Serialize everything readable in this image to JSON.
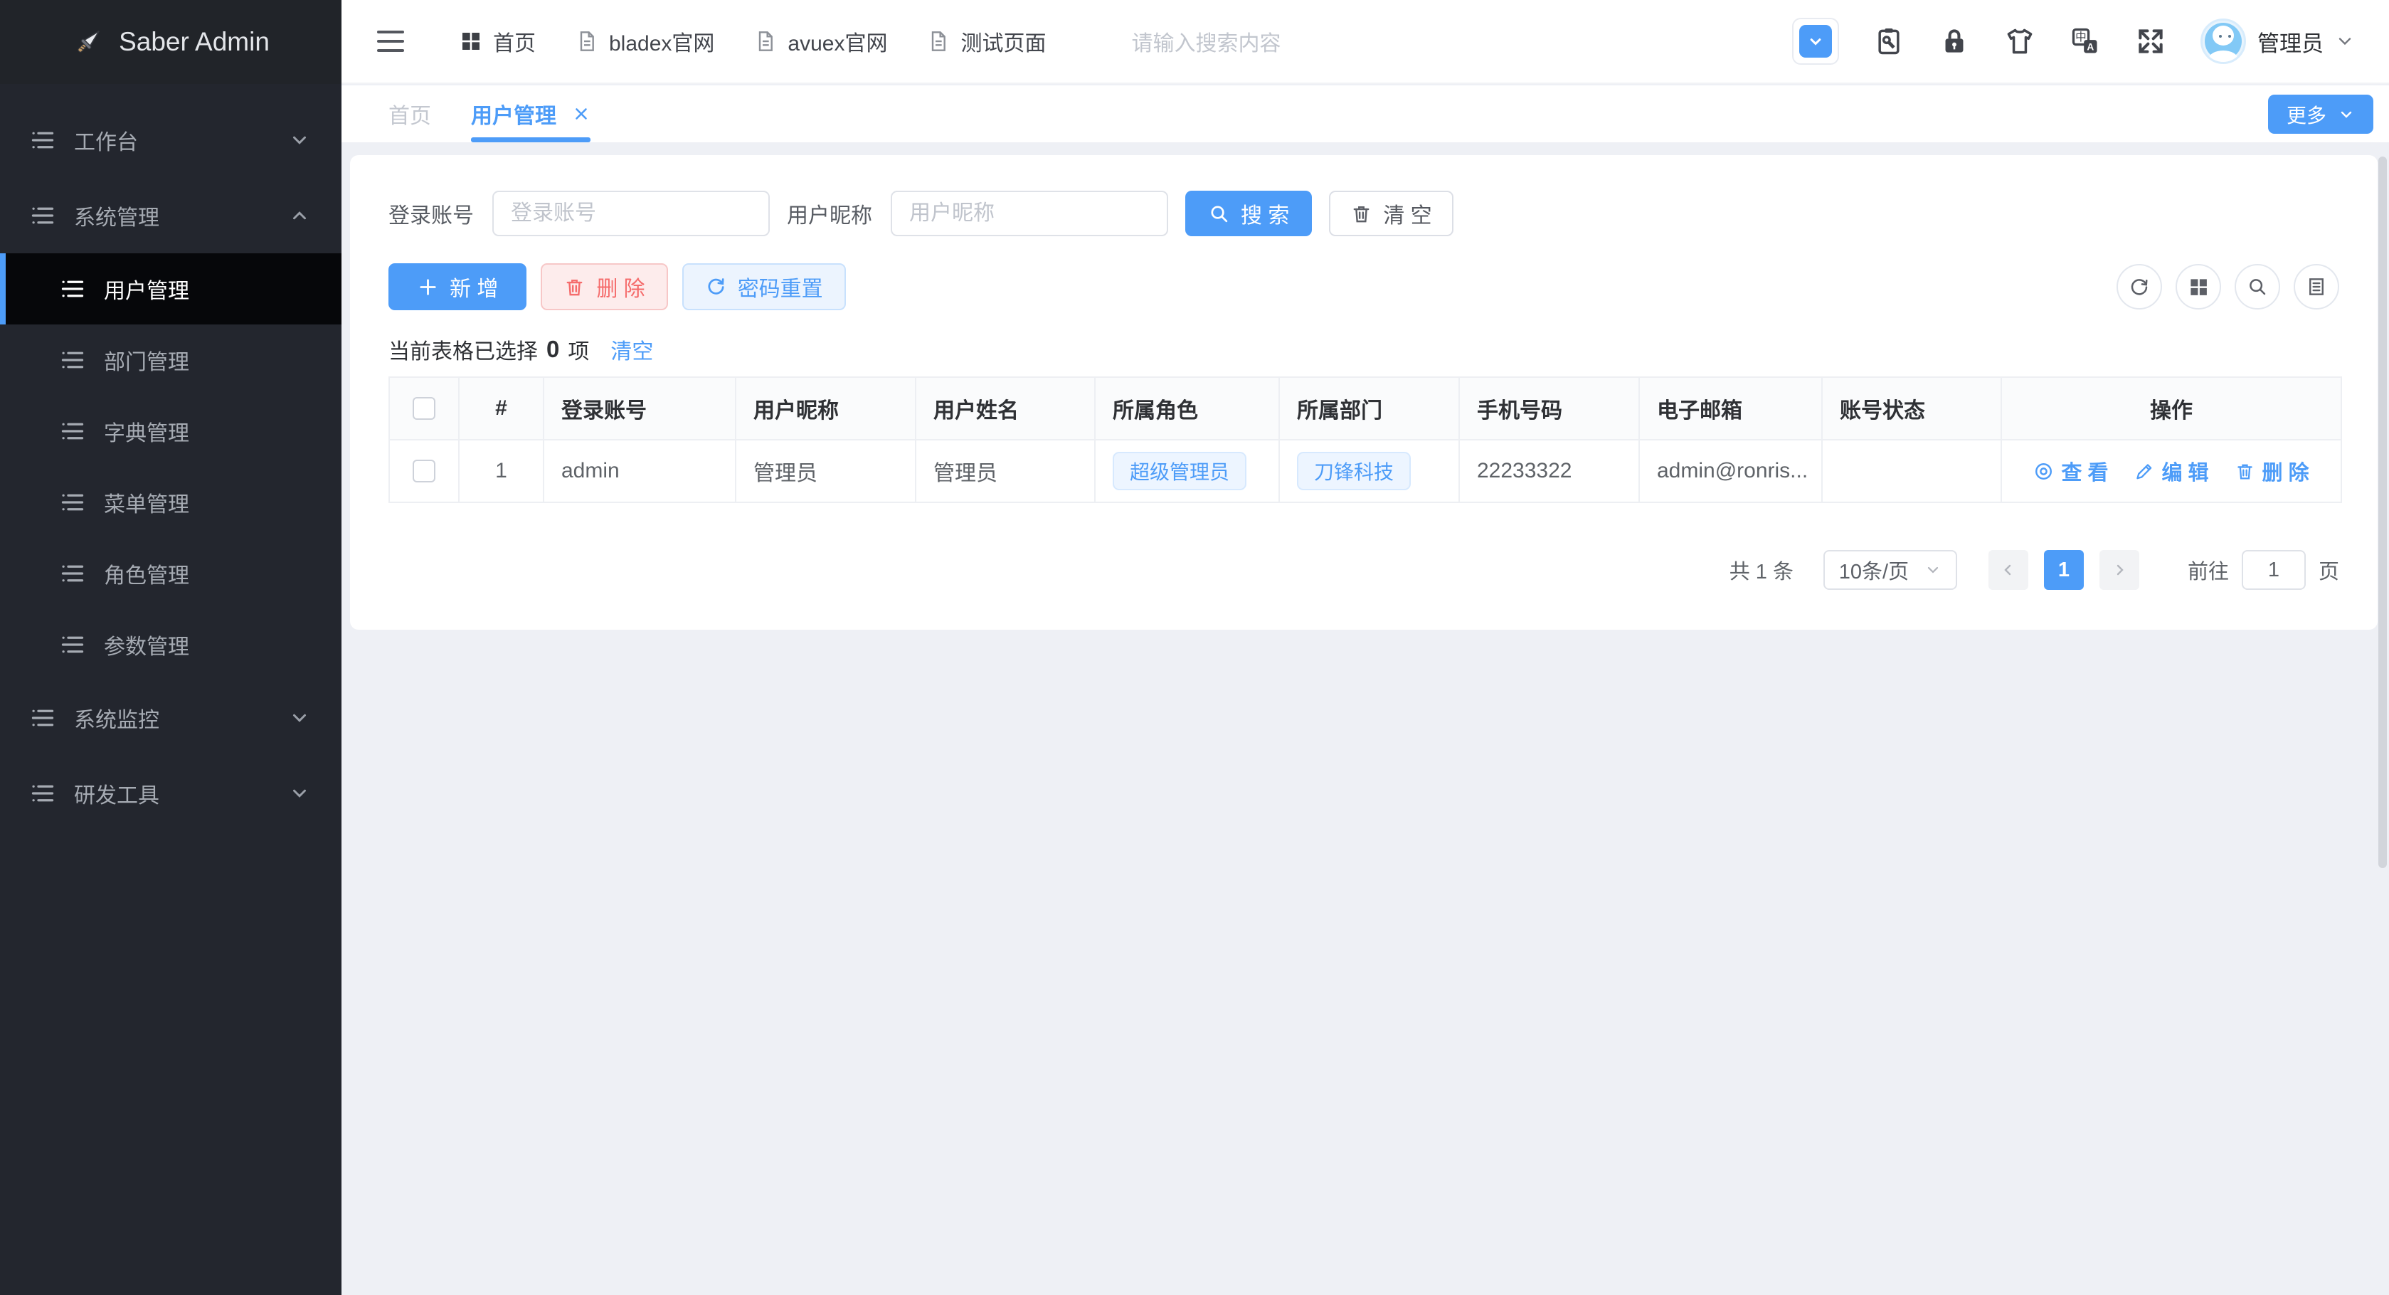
{
  "colors": {
    "primary": "#4d9cf8",
    "danger": "#f56c6c",
    "sidebar_bg": "#23262e",
    "active_item_bg": "#06070a",
    "page_bg": "#eef0f5",
    "tag_bg": "#edf5ff"
  },
  "sidebar": {
    "logo_text": "Saber Admin",
    "items": [
      {
        "label": "工作台",
        "level": "top",
        "chevron": "down"
      },
      {
        "label": "系统管理",
        "level": "top",
        "chevron": "up"
      },
      {
        "label": "用户管理",
        "level": "sub",
        "active": true
      },
      {
        "label": "部门管理",
        "level": "sub"
      },
      {
        "label": "字典管理",
        "level": "sub"
      },
      {
        "label": "菜单管理",
        "level": "sub"
      },
      {
        "label": "角色管理",
        "level": "sub"
      },
      {
        "label": "参数管理",
        "level": "sub"
      },
      {
        "label": "系统监控",
        "level": "top",
        "chevron": "down"
      },
      {
        "label": "研发工具",
        "level": "top",
        "chevron": "down"
      }
    ]
  },
  "topbar": {
    "nav": [
      {
        "label": "首页",
        "icon": "grid"
      },
      {
        "label": "bladex官网",
        "icon": "document"
      },
      {
        "label": "avuex官网",
        "icon": "document"
      },
      {
        "label": "测试页面",
        "icon": "document"
      }
    ],
    "search_placeholder": "请输入搜索内容",
    "user_name": "管理员"
  },
  "tabs": {
    "items": [
      {
        "label": "首页",
        "active": false
      },
      {
        "label": "用户管理",
        "active": true,
        "closable": true
      }
    ],
    "more_label": "更多"
  },
  "filters": {
    "fields": [
      {
        "label": "登录账号",
        "placeholder": "登录账号",
        "value": ""
      },
      {
        "label": "用户昵称",
        "placeholder": "用户昵称",
        "value": ""
      }
    ],
    "search_label": "搜 索",
    "clear_label": "清 空"
  },
  "actions": {
    "add_label": "新 增",
    "delete_label": "删 除",
    "reset_password_label": "密码重置"
  },
  "selection": {
    "prefix": "当前表格已选择",
    "count": "0",
    "suffix": "项",
    "clear_label": "清空"
  },
  "table": {
    "headers": [
      "#",
      "登录账号",
      "用户昵称",
      "用户姓名",
      "所属角色",
      "所属部门",
      "手机号码",
      "电子邮箱",
      "账号状态",
      "操作"
    ],
    "rows": [
      {
        "index": "1",
        "account": "admin",
        "nickname": "管理员",
        "realname": "管理员",
        "role": "超级管理员",
        "dept": "刀锋科技",
        "phone": "22233322",
        "email": "admin@ronris...",
        "status": "",
        "ops": [
          "查 看",
          "编 辑",
          "删 除"
        ]
      }
    ]
  },
  "pagination": {
    "total": "共 1 条",
    "page_size": "10条/页",
    "current_page": "1",
    "goto_label": "前往",
    "goto_value": "1",
    "page_unit": "页"
  }
}
